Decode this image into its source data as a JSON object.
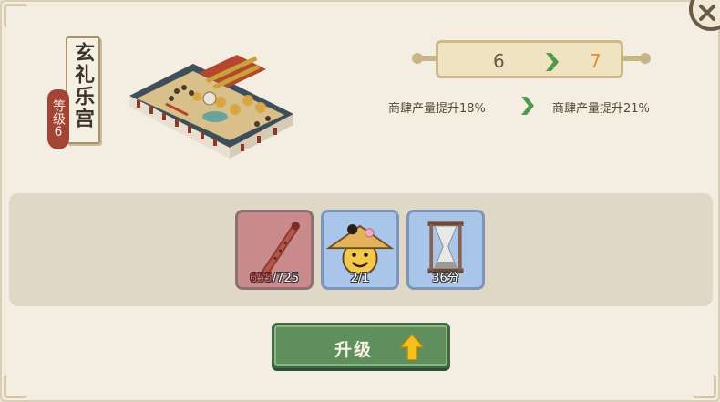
{
  "building": {
    "name": "玄礼乐宫",
    "level_label": "等级",
    "level_value": "6"
  },
  "upgrade_preview": {
    "level_from": "6",
    "level_to": "7",
    "bonus_from": "商肆产量提升18%",
    "bonus_to": "商肆产量提升21%"
  },
  "requirements": [
    {
      "icon": "flute-icon",
      "current": "655",
      "required": "/725",
      "insufficient": true
    },
    {
      "icon": "worker-face-icon",
      "value": "2/1"
    },
    {
      "icon": "hourglass-icon",
      "value": "36分"
    }
  ],
  "buttons": {
    "upgrade_label": "升级"
  },
  "colors": {
    "insufficient": "#ff4a4a",
    "next_level": "#e88b2f",
    "button_green": "#5f8f5c",
    "level_tag": "#a24537"
  }
}
